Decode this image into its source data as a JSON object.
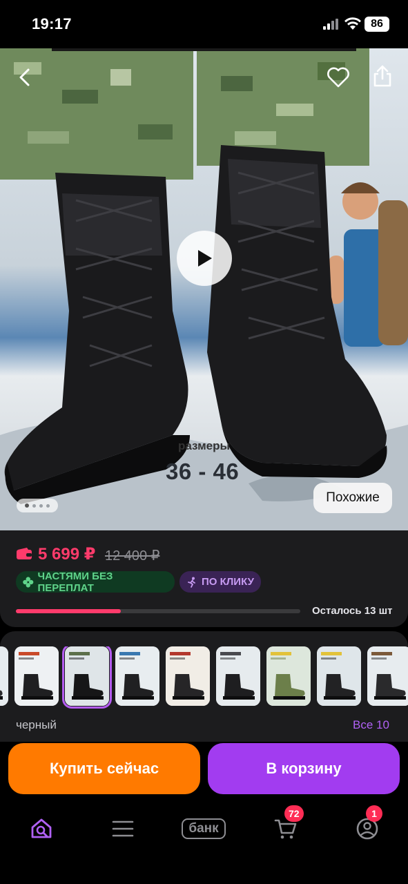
{
  "status_bar": {
    "time": "19:17",
    "battery": "86"
  },
  "hero": {
    "sizes_label": "размеры",
    "sizes_value": "36 - 46",
    "similar_button": "Похожие",
    "gallery_dots": 4,
    "icons": {
      "back": "chevron-left-icon",
      "favorite": "heart-icon",
      "share": "share-icon",
      "play": "play-icon"
    }
  },
  "price": {
    "current": "5 699 ₽",
    "old": "12 400 ₽",
    "color_accent": "#ff3b6b",
    "badges": {
      "installment": "ЧАСТЯМИ БЕЗ ПЕРЕПЛАТ",
      "click": "ПО КЛИКУ"
    },
    "stock_text": "Осталось 13 шт",
    "stock_progress": 0.37
  },
  "variants": {
    "selected_color": "черный",
    "all_link": "Все 10",
    "thumbnails": [
      {
        "name": "variant-1"
      },
      {
        "name": "variant-2"
      },
      {
        "name": "variant-3"
      },
      {
        "name": "variant-4"
      },
      {
        "name": "variant-5"
      },
      {
        "name": "variant-6"
      },
      {
        "name": "variant-7"
      },
      {
        "name": "variant-8"
      },
      {
        "name": "variant-9"
      }
    ],
    "selected_index": 2
  },
  "actions": {
    "buy_now": "Купить сейчас",
    "add_to_cart": "В корзину",
    "buy_color": "#ff7a00",
    "cart_color": "#a23cf0"
  },
  "nav": {
    "bank_label": "банк",
    "cart_badge": "72",
    "profile_badge": "1",
    "icons": [
      "home-search-icon",
      "menu-icon",
      "bank-icon",
      "cart-icon",
      "profile-icon"
    ]
  }
}
